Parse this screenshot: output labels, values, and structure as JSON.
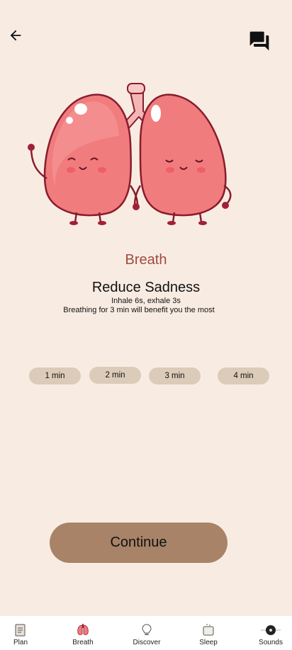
{
  "header": {
    "back_icon": "arrow-left-icon",
    "chat_icon": "chat-bubbles-icon"
  },
  "main": {
    "section_label": "Breath",
    "title": "Reduce Sadness",
    "instruction": "Inhale 6s, exhale 3s",
    "recommendation": "Breathing for 3 min will benefit you the most",
    "durations": [
      "1 min",
      "2 min",
      "3 min",
      "4 min"
    ],
    "continue_label": "Continue"
  },
  "nav": {
    "items": [
      {
        "label": "Plan",
        "icon": "plan-notes-icon"
      },
      {
        "label": "Breath",
        "icon": "lungs-icon"
      },
      {
        "label": "Discover",
        "icon": "lightbulb-icon"
      },
      {
        "label": "Sleep",
        "icon": "sleep-jar-icon"
      },
      {
        "label": "Sounds",
        "icon": "vinyl-record-icon"
      }
    ]
  },
  "colors": {
    "background": "#f8ece2",
    "accent": "#a1493c",
    "button": "#a88367",
    "chip": "#dccbb9"
  }
}
